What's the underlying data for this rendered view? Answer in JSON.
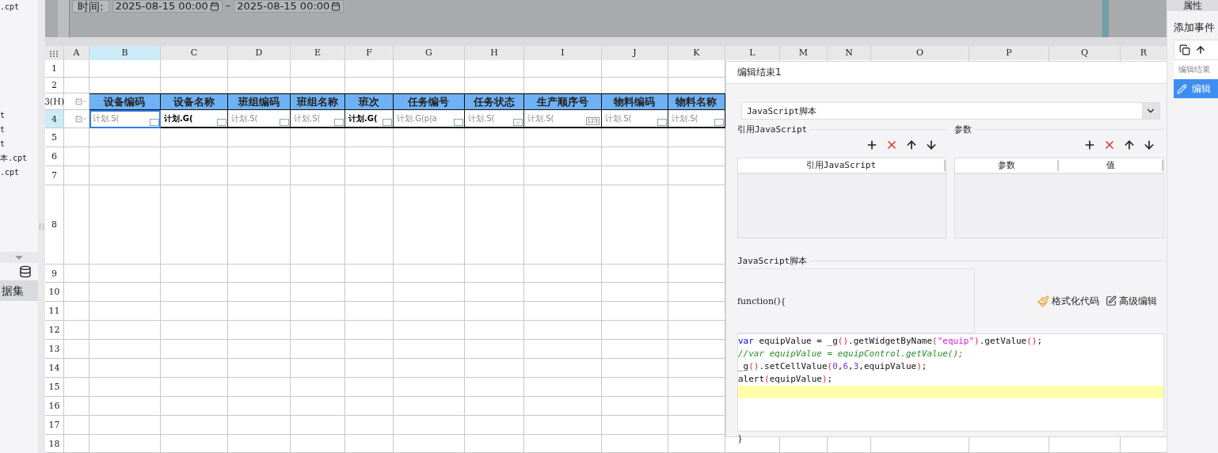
{
  "sidebar": {
    "files": [
      {
        "label": ".cpt",
        "selected": false
      },
      {
        "label": "t",
        "selected": false
      },
      {
        "label": "t",
        "selected": false
      },
      {
        "label": "t",
        "selected": false
      },
      {
        "label": "本.cpt",
        "selected": false
      },
      {
        "label": ".cpt",
        "selected": false
      }
    ],
    "tab": "据集"
  },
  "canvas": {
    "time_label": "时间:",
    "start": "2025-08-15 00:00",
    "separator": "–",
    "end": "2025-08-15 00:00"
  },
  "sheet": {
    "columns": [
      {
        "label": "A",
        "selected": false
      },
      {
        "label": "B",
        "selected": true
      },
      {
        "label": "C",
        "selected": false
      },
      {
        "label": "D",
        "selected": false
      },
      {
        "label": "E",
        "selected": false
      },
      {
        "label": "F",
        "selected": false
      },
      {
        "label": "G",
        "selected": false
      },
      {
        "label": "H",
        "selected": false
      },
      {
        "label": "I",
        "selected": false
      },
      {
        "label": "J",
        "selected": false
      },
      {
        "label": "K",
        "selected": false
      },
      {
        "label": "L",
        "selected": false
      },
      {
        "label": "M",
        "selected": false
      },
      {
        "label": "N",
        "selected": false
      },
      {
        "label": "O",
        "selected": false
      },
      {
        "label": "P",
        "selected": false
      },
      {
        "label": "Q",
        "selected": false
      },
      {
        "label": "R",
        "selected": false
      }
    ],
    "rows": [
      {
        "label": "1",
        "kind": "blank",
        "selected": false
      },
      {
        "label": "2",
        "kind": "blank",
        "selected": false
      },
      {
        "label": "3(H)",
        "kind": "header",
        "selected": false
      },
      {
        "label": "4",
        "kind": "formula",
        "selected": true
      },
      {
        "label": "5",
        "kind": "blank",
        "selected": false
      },
      {
        "label": "6",
        "kind": "blank",
        "selected": false
      },
      {
        "label": "7",
        "kind": "blank",
        "selected": false
      },
      {
        "label": "8",
        "kind": "blank",
        "selected": false
      },
      {
        "label": "9",
        "kind": "blank",
        "selected": false
      },
      {
        "label": "10",
        "kind": "blank",
        "selected": false
      },
      {
        "label": "11",
        "kind": "blank",
        "selected": false
      },
      {
        "label": "12",
        "kind": "blank",
        "selected": false
      },
      {
        "label": "13",
        "kind": "blank",
        "selected": false
      },
      {
        "label": "14",
        "kind": "blank",
        "selected": false
      },
      {
        "label": "15",
        "kind": "blank",
        "selected": false
      },
      {
        "label": "16",
        "kind": "blank",
        "selected": false
      },
      {
        "label": "17",
        "kind": "blank",
        "selected": false
      },
      {
        "label": "18",
        "kind": "blank",
        "selected": false
      }
    ],
    "header_cells": [
      "设备编码",
      "设备名称",
      "班组编码",
      "班组名称",
      "班次",
      "任务编号",
      "任务状态",
      "生产顺序号",
      "物料编码",
      "物料名称"
    ],
    "formula_cells": [
      {
        "text": "计划.S(",
        "kind": "text",
        "emphasis": false,
        "selected": true
      },
      {
        "text": "计划.G(",
        "kind": "text",
        "emphasis": true,
        "selected": false
      },
      {
        "text": "计划.S(",
        "kind": "text",
        "emphasis": false,
        "selected": false
      },
      {
        "text": "计划.S(",
        "kind": "text",
        "emphasis": false,
        "selected": false
      },
      {
        "text": "计划.G(",
        "kind": "text",
        "emphasis": true,
        "selected": false
      },
      {
        "text": "计划.G(p|a",
        "kind": "text",
        "emphasis": false,
        "selected": false
      },
      {
        "text": "计划.S(",
        "kind": "combo",
        "emphasis": false,
        "selected": false
      },
      {
        "text": "计划.S(",
        "kind": "number",
        "widget_label": "123",
        "emphasis": false,
        "selected": false
      },
      {
        "text": "计划.S(",
        "kind": "text",
        "emphasis": false,
        "selected": false
      },
      {
        "text": "计划.S(",
        "kind": "text",
        "emphasis": false,
        "selected": false
      }
    ]
  },
  "dialog": {
    "title": "编辑结束1",
    "type_select": "JavaScript脚本",
    "ref_section": {
      "legend": "引用JavaScript",
      "columns": [
        "引用JavaScript"
      ]
    },
    "param_section": {
      "legend": "参数",
      "columns": [
        "参数",
        "值"
      ]
    },
    "script_section": {
      "legend": "JavaScript脚本",
      "signature": "function(){",
      "format_button": "格式化代码",
      "advanced_button": "高级编辑",
      "closing": "}",
      "lines": [
        {
          "current": false,
          "tokens": [
            {
              "text": "var",
              "kind": "keyword"
            },
            {
              "text": " equipValue = _g",
              "kind": "plain"
            },
            {
              "text": "()",
              "kind": "paren"
            },
            {
              "text": ".getWidgetByName",
              "kind": "plain"
            },
            {
              "text": "(",
              "kind": "paren"
            },
            {
              "text": "\"equip\"",
              "kind": "string"
            },
            {
              "text": ")",
              "kind": "paren"
            },
            {
              "text": ".getValue",
              "kind": "plain"
            },
            {
              "text": "()",
              "kind": "paren"
            },
            {
              "text": ";",
              "kind": "plain"
            }
          ]
        },
        {
          "current": false,
          "tokens": [
            {
              "text": "//var equipValue = equipControl.getValue();",
              "kind": "comment"
            }
          ]
        },
        {
          "current": false,
          "tokens": [
            {
              "text": "_g",
              "kind": "plain"
            },
            {
              "text": "()",
              "kind": "paren"
            },
            {
              "text": ".setCellValue",
              "kind": "plain"
            },
            {
              "text": "(",
              "kind": "paren"
            },
            {
              "text": "0",
              "kind": "number"
            },
            {
              "text": ",",
              "kind": "plain"
            },
            {
              "text": "6",
              "kind": "number"
            },
            {
              "text": ",",
              "kind": "plain"
            },
            {
              "text": "3",
              "kind": "number"
            },
            {
              "text": ",equipValue",
              "kind": "plain"
            },
            {
              "text": ")",
              "kind": "paren"
            },
            {
              "text": ";",
              "kind": "plain"
            }
          ]
        },
        {
          "current": false,
          "tokens": [
            {
              "text": "alert",
              "kind": "plain"
            },
            {
              "text": "(",
              "kind": "paren"
            },
            {
              "text": "equipValue",
              "kind": "plain"
            },
            {
              "text": ")",
              "kind": "paren"
            },
            {
              "text": ";",
              "kind": "plain"
            }
          ]
        },
        {
          "current": true
        }
      ]
    }
  },
  "right_panel": {
    "title": "属性",
    "add_event": "添加事件",
    "events": [
      {
        "label": "编辑结束",
        "kind": "group",
        "selected": false
      },
      {
        "label": "编辑",
        "kind": "item",
        "selected": true
      }
    ]
  }
}
